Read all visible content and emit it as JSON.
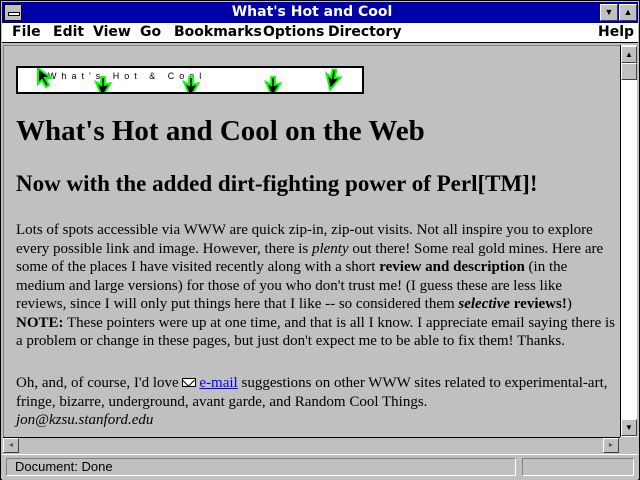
{
  "window": {
    "title": "What's Hot and Cool",
    "minimize_glyph": "▼",
    "maximize_glyph": "▲"
  },
  "menubar": {
    "items": [
      {
        "label": "File"
      },
      {
        "label": "Edit"
      },
      {
        "label": "View"
      },
      {
        "label": "Go"
      },
      {
        "label": "Bookmarks"
      },
      {
        "label": "Options"
      },
      {
        "label": "Directory"
      },
      {
        "label": "Help"
      }
    ]
  },
  "page": {
    "banner_text": "What's Hot & Cool",
    "heading": "What's Hot and Cool on the Web",
    "subheading": "Now with the added dirt-fighting power of Perl[TM]!",
    "intro": {
      "part1": "Lots of spots accessible via WWW are quick zip-in, zip-out visits. Not all inspire you to explore every possible link and image. However, there is ",
      "plenty": "plenty",
      "part2": " out there! Some real gold mines. Here are some of the places I have visited recently along with a short ",
      "review_desc": "review and description",
      "part3": " (in the medium and large versions) for those of you who don't trust me! (I guess these are less like reviews, since I will only put things here that I like -- so considered them ",
      "selective": "selective",
      "reviews": " reviews!",
      "part4": ")",
      "note_label": "NOTE:",
      "note_text": " These pointers were up at one time, and that is all I know. I appreciate email saying there is a problem or change in these pages, but just don't expect me to be able to fix them! Thanks."
    },
    "contact": {
      "part1": "Oh, and, of course, I'd love ",
      "email_link": "e-mail",
      "part2": " suggestions on other WWW sites related to experimental-art, fringe, bizarre, underground, avant garde, and Random Cool Things.",
      "address": "jon@kzsu.stanford.edu"
    }
  },
  "scrollbars": {
    "up_glyph": "▲",
    "down_glyph": "▼",
    "left_glyph": "◄",
    "right_glyph": "►"
  },
  "statusbar": {
    "text": "Document: Done"
  },
  "colors": {
    "titlebar": "#0000a8",
    "link": "#0000ff",
    "arrow_fill": "#000000",
    "arrow_glow": "#00ff00"
  },
  "icons": [
    "system-menu-icon",
    "arrow-cursor-icon",
    "mail-icon"
  ]
}
